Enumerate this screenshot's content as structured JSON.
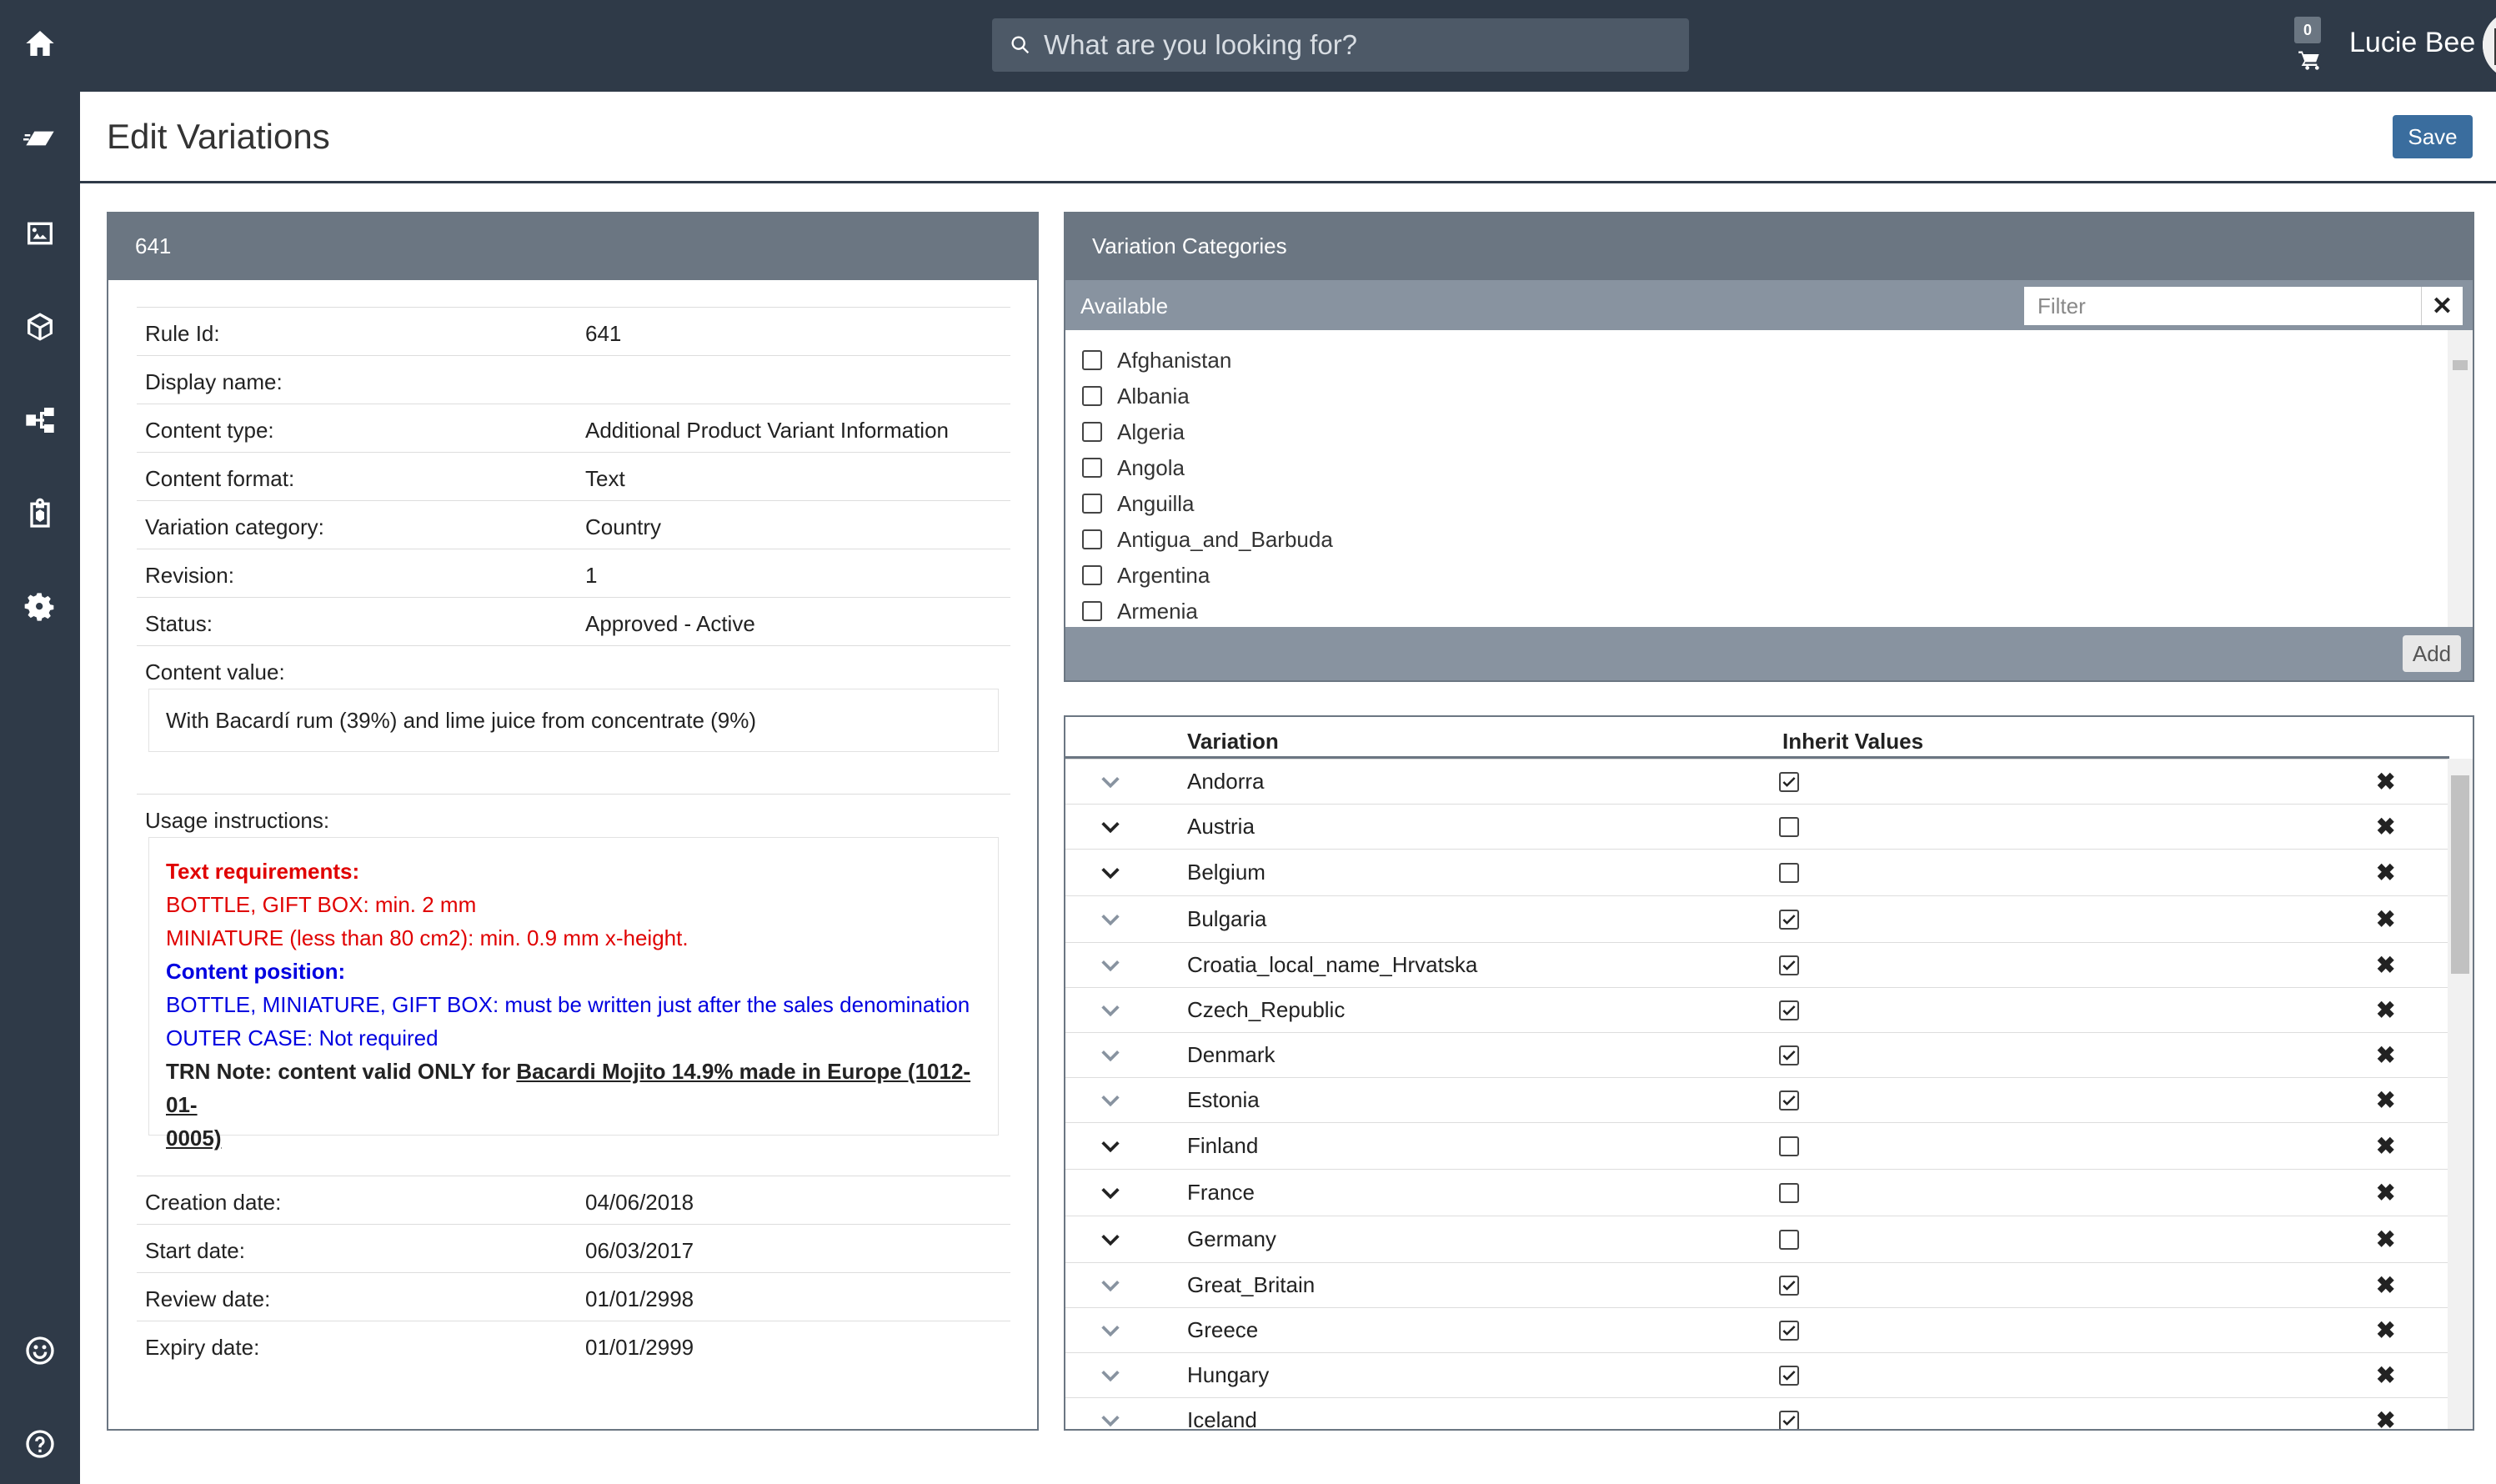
{
  "topbar": {
    "search_placeholder": "What are you looking for?",
    "cart_count": "0",
    "user_name": "Lucie Bee"
  },
  "header": {
    "title": "Edit Variations",
    "save_label": "Save"
  },
  "rule_panel": {
    "title": "641",
    "rows": [
      {
        "label": "Rule Id:",
        "value": "641"
      },
      {
        "label": "Display name:",
        "value": ""
      },
      {
        "label": "Content type:",
        "value": "Additional Product Variant Information"
      },
      {
        "label": "Content format:",
        "value": "Text"
      },
      {
        "label": "Variation category:",
        "value": "Country"
      },
      {
        "label": "Revision:",
        "value": "1"
      },
      {
        "label": "Status:",
        "value": "Approved - Active"
      }
    ],
    "content_value_label": "Content value:",
    "content_value": "With Bacardí rum (39%) and lime juice from concentrate (9%)",
    "usage_label": "Usage instructions:",
    "usage": {
      "text_req_heading": "Text requirements:",
      "text_req_line1": "BOTTLE, GIFT BOX: min. 2 mm",
      "text_req_line2": "MINIATURE (less than 80 cm2): min. 0.9 mm x-height.",
      "pos_heading": "Content position:",
      "pos_line1": "BOTTLE, MINIATURE, GIFT BOX: must be written just after the sales denomination",
      "pos_line2": "OUTER CASE: Not required",
      "trn_prefix": "TRN Note: content valid ONLY for ",
      "trn_link_a": "Bacardi Mojito 14.9% made in Europe (1012-01-",
      "trn_link_b": "0005)"
    },
    "dates": [
      {
        "label": "Creation date:",
        "value": "04/06/2018"
      },
      {
        "label": "Start date:",
        "value": "06/03/2017"
      },
      {
        "label": "Review date:",
        "value": "01/01/2998"
      },
      {
        "label": "Expiry date:",
        "value": "01/01/2999"
      }
    ]
  },
  "categories_panel": {
    "title": "Variation Categories",
    "available_label": "Available",
    "filter_placeholder": "Filter",
    "add_label": "Add",
    "available": [
      "Afghanistan",
      "Albania",
      "Algeria",
      "Angola",
      "Anguilla",
      "Antigua_and_Barbuda",
      "Argentina",
      "Armenia"
    ]
  },
  "variations": {
    "col_variation": "Variation",
    "col_inherit": "Inherit Values",
    "rows": [
      {
        "name": "Andorra",
        "inherit": true,
        "chev_dark": false
      },
      {
        "name": "Austria",
        "inherit": false,
        "chev_dark": true
      },
      {
        "name": "Belgium",
        "inherit": false,
        "chev_dark": true
      },
      {
        "name": "Bulgaria",
        "inherit": true,
        "chev_dark": false
      },
      {
        "name": "Croatia_local_name_Hrvatska",
        "inherit": true,
        "chev_dark": false
      },
      {
        "name": "Czech_Republic",
        "inherit": true,
        "chev_dark": false
      },
      {
        "name": "Denmark",
        "inherit": true,
        "chev_dark": false
      },
      {
        "name": "Estonia",
        "inherit": true,
        "chev_dark": false
      },
      {
        "name": "Finland",
        "inherit": false,
        "chev_dark": true
      },
      {
        "name": "France",
        "inherit": false,
        "chev_dark": true
      },
      {
        "name": "Germany",
        "inherit": false,
        "chev_dark": true
      },
      {
        "name": "Great_Britain",
        "inherit": true,
        "chev_dark": false
      },
      {
        "name": "Greece",
        "inherit": true,
        "chev_dark": false
      },
      {
        "name": "Hungary",
        "inherit": true,
        "chev_dark": false
      },
      {
        "name": "Iceland",
        "inherit": true,
        "chev_dark": false
      }
    ]
  },
  "colors": {
    "chrome": "#2f3a48",
    "panel_head": "#6b7682",
    "accent": "#3a6d9e",
    "warning_text": "#e00000",
    "info_text": "#0000e0"
  }
}
